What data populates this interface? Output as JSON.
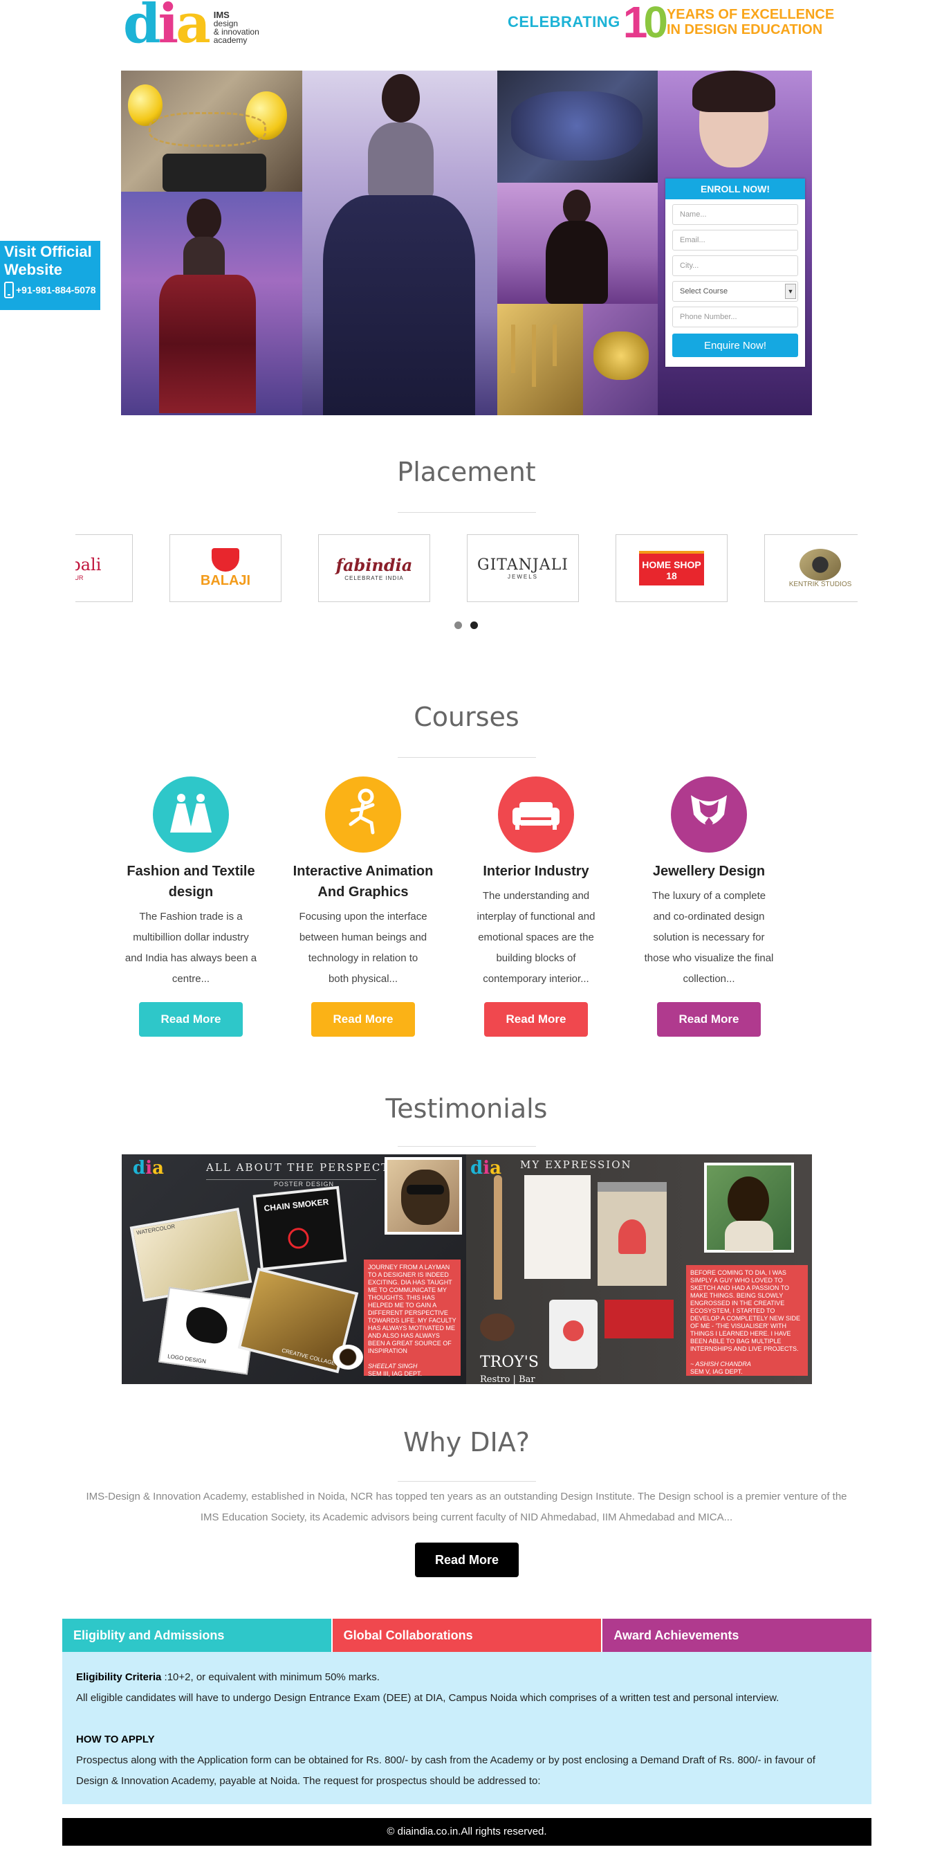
{
  "header": {
    "logo_mark": "dia",
    "logo_line1": "IMS",
    "logo_line2": "design",
    "logo_line3": "& innovation",
    "logo_line4": "academy",
    "tag_celebrating": "CELEBRATING",
    "tag_number": "10",
    "tag_years_line1": "YEARS OF EXCELLENCE",
    "tag_years_line2": "IN DESIGN EDUCATION"
  },
  "side_badge": {
    "line1": "Visit Official",
    "line2": "Website",
    "phone": "+91-981-884-5078"
  },
  "enroll": {
    "title": "ENROLL NOW!",
    "name_placeholder": "Name...",
    "email_placeholder": "Email...",
    "city_placeholder": "City...",
    "course_selected": "Select Course",
    "phone_placeholder": "Phone Number...",
    "submit_label": "Enquire Now!"
  },
  "placement": {
    "title": "Placement",
    "brands": [
      "rapali",
      "BALAJI",
      "fabindia",
      "GITANJALI",
      "HOME SHOP 18",
      "KENTRIK STUDIOS"
    ],
    "brand_subs": [
      "PUR",
      "",
      "CELEBRATE INDIA",
      "JEWELS",
      "",
      ""
    ],
    "slides_total": 2,
    "active_slide": 2
  },
  "courses": {
    "title": "Courses",
    "items": [
      {
        "title_line1": "Fashion and Textile",
        "title_line2": "design",
        "desc": [
          "The Fashion trade is a",
          "multibillion dollar industry",
          "and India has always been a",
          "centre..."
        ],
        "button": "Read More",
        "color": "#2ec7c9"
      },
      {
        "title_line1": "Interactive Animation",
        "title_line2": "And Graphics",
        "desc": [
          "Focusing upon the interface",
          "between human beings and",
          "technology in relation to",
          "both physical..."
        ],
        "button": "Read More",
        "color": "#fbb216"
      },
      {
        "title_line1": "Interior Industry",
        "title_line2": "",
        "desc": [
          "The understanding and",
          "interplay of functional and",
          "emotional spaces are the",
          "building blocks of",
          "contemporary interior..."
        ],
        "button": "Read More",
        "color": "#f0484e"
      },
      {
        "title_line1": "Jewellery Design",
        "title_line2": "",
        "desc": [
          "The luxury of a complete",
          "and co-ordinated design",
          "solution is necessary for",
          "those who visualize the final",
          "collection..."
        ],
        "button": "Read More",
        "color": "#b03a8e"
      }
    ]
  },
  "testimonials": {
    "title": "Testimonials",
    "left_heading": "ALL ABOUT THE PERSPECTIVE",
    "right_heading": "MY EXPRESSION",
    "left_labels": [
      "POSTER DESIGN",
      "CHAIN SMOKER",
      "WATERCOLOR",
      "LOGO DESIGN",
      "CREATIVE COLLAGE"
    ],
    "left_quote": "JOURNEY FROM A LAYMAN TO A DESIGNER IS INDEED EXCITING. DIA HAS TAUGHT ME TO COMMUNICATE MY THOUGHTS. THIS HAS HELPED ME TO GAIN A DIFFERENT PERSPECTIVE TOWARDS LIFE. MY FACULTY HAS ALWAYS MOTIVATED ME AND ALSO HAS ALWAYS BEEN A GREAT SOURCE OF INSPIRATION",
    "left_name": "SHEELAT SINGH",
    "left_sem": "SEM III, IAG DEPT.",
    "right_quote": "BEFORE COMING TO DIA, I WAS SIMPLY A GUY WHO LOVED TO SKETCH AND HAD A PASSION TO MAKE THINGS. BEING SLOWLY ENGROSSED IN THE CREATIVE ECOSYSTEM, I STARTED TO DEVELOP A COMPLETELY NEW SIDE OF ME - 'The Visualiser' WITH THINGS I LEARNED HERE. I HAVE BEEN ABLE TO BAG MULTIPLE INTERNSHIPS AND LIVE PROJECTS.",
    "right_name": "~ Ashish Chandra",
    "right_sem": "SEM V, IAG DEPT.",
    "troys": "TROY'S",
    "troys_sub": "Restro | Bar"
  },
  "why": {
    "title": "Why DIA?",
    "text_line1": "IMS-Design & Innovation Academy, established in Noida, NCR has topped ten years as an outstanding Design Institute. The Design school is a premier venture of the",
    "text_line2": "IMS Education Society, its Academic advisors being current faculty of NID Ahmedabad, IIM Ahmedabad and MICA...",
    "button": "Read More"
  },
  "tabs": {
    "items": [
      {
        "label": "Eligiblity and Admissions",
        "color": "#2ec7c9"
      },
      {
        "label": "Global Collaborations",
        "color": "#f0484e"
      },
      {
        "label": "Award Achievements",
        "color": "#b03a8e"
      }
    ],
    "elig_label": "Eligibility Criteria",
    "elig_text": " :10+2, or equivalent with minimum 50% marks.",
    "elig_line2": "All eligible candidates will have to undergo Design Entrance Exam (DEE) at DIA, Campus Noida which comprises of a written test and personal interview.",
    "how_heading": "HOW TO APPLY",
    "how_line1": "Prospectus along with the Application form can be obtained for Rs. 800/- by cash from the Academy or by post enclosing a Demand Draft of Rs. 800/- in favour of",
    "how_line2": "Design & Innovation Academy, payable at Noida. The request for prospectus should be addressed to:"
  },
  "footer": {
    "text": "© diaindia.co.in.All rights reserved."
  }
}
